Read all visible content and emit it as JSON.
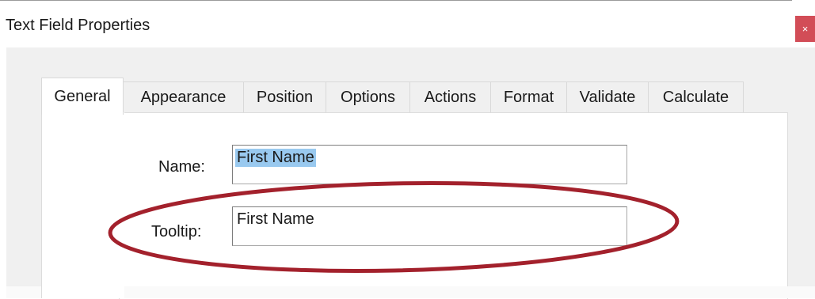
{
  "window": {
    "title": "Text Field Properties",
    "close_label": "×"
  },
  "tabs": [
    {
      "label": "General",
      "active": true
    },
    {
      "label": "Appearance"
    },
    {
      "label": "Position"
    },
    {
      "label": "Options"
    },
    {
      "label": "Actions"
    },
    {
      "label": "Format"
    },
    {
      "label": "Validate"
    },
    {
      "label": "Calculate"
    }
  ],
  "form": {
    "name_label": "Name:",
    "name_value": "First Name",
    "tooltip_label": "Tooltip:",
    "tooltip_value": "First Name"
  },
  "colors": {
    "close_button": "#d24d57",
    "selection": "#99c9ef",
    "annotation": "#a3212c"
  }
}
